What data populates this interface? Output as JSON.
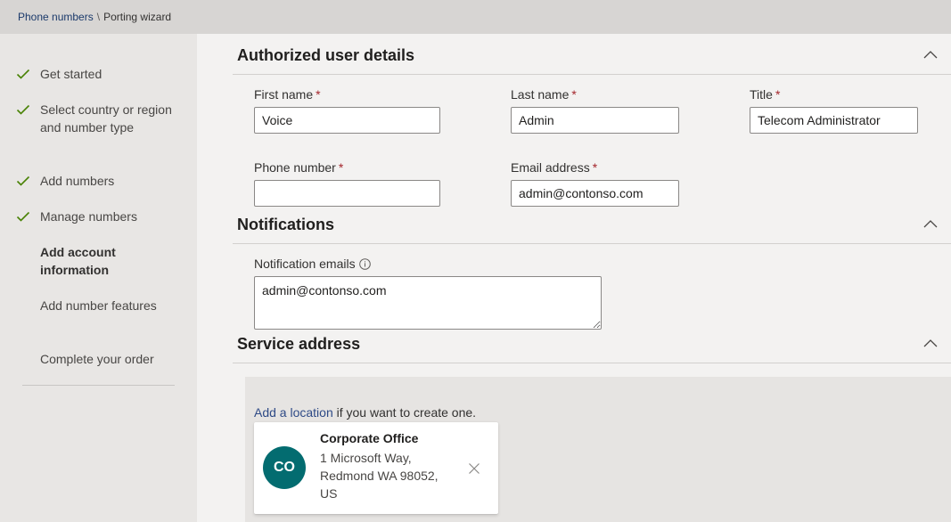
{
  "breadcrumb": {
    "parent": "Phone numbers",
    "separator": "\\",
    "current": "Porting wizard"
  },
  "wizard_steps": [
    {
      "label": "Get started",
      "status": "complete"
    },
    {
      "label": "Select country or region and number type",
      "status": "complete"
    },
    {
      "label": "Add numbers",
      "status": "complete"
    },
    {
      "label": "Manage numbers",
      "status": "complete"
    },
    {
      "label": "Add account information",
      "status": "current"
    },
    {
      "label": "Add number features",
      "status": "pending"
    },
    {
      "label": "Complete your order",
      "status": "pending"
    }
  ],
  "authorized_user": {
    "title": "Authorized user details",
    "first_name": {
      "label": "First name",
      "required_mark": "*",
      "value": "Voice"
    },
    "last_name": {
      "label": "Last name",
      "required_mark": "*",
      "value": "Admin"
    },
    "job_title": {
      "label": "Title",
      "required_mark": "*",
      "value": "Telecom Administrator"
    },
    "phone_number": {
      "label": "Phone number",
      "required_mark": "*",
      "value": ""
    },
    "email": {
      "label": "Email address",
      "required_mark": "*",
      "value": "admin@contonso.com"
    }
  },
  "notifications": {
    "title": "Notifications",
    "emails_label": "Notification emails",
    "emails_value": "admin@contonso.com"
  },
  "service_address": {
    "title": "Service address",
    "add_location_link": "Add a location",
    "add_location_suffix": " if you want to create one.",
    "location": {
      "initials": "CO",
      "name": "Corporate Office",
      "address": "1 Microsoft Way, Redmond WA 98052, US"
    }
  },
  "icons": {
    "check": "checkmark-icon",
    "collapse": "chevron-up-icon",
    "info": "info-icon",
    "remove": "close-icon"
  },
  "colors": {
    "check_green": "#498205",
    "avatar_teal": "#036c70",
    "link_blue": "#2e4a86",
    "required_red": "#a4262c"
  }
}
